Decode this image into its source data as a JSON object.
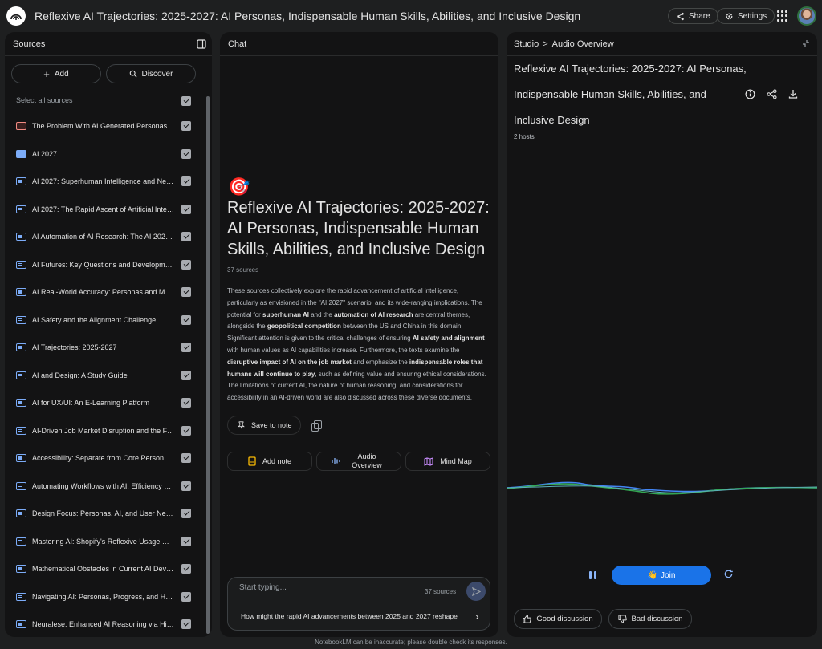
{
  "app": {
    "title": "Reflexive AI Trajectories: 2025-2027: AI Personas, Indispensable Human Skills, Abilities, and Inclusive Design",
    "share_label": "Share",
    "settings_label": "Settings"
  },
  "sources": {
    "header": "Sources",
    "add_label": "Add",
    "discover_label": "Discover",
    "select_all_label": "Select all sources",
    "items": [
      {
        "label": "The Problem With AI Generated Personas...",
        "icon": "pdf-icon"
      },
      {
        "label": "AI 2027",
        "icon": "web-icon"
      },
      {
        "label": "AI 2027: Superhuman Intelligence and Near-...",
        "icon": "doc-icon"
      },
      {
        "label": "AI 2027: The Rapid Ascent of Artificial Intelli...",
        "icon": "doc-icon"
      },
      {
        "label": "AI Automation of AI Research: The AI 2027 S...",
        "icon": "doc-icon"
      },
      {
        "label": "AI Futures: Key Questions and Developments",
        "icon": "doc-icon"
      },
      {
        "label": "AI Real-World Accuracy: Personas and Mod...",
        "icon": "doc-icon"
      },
      {
        "label": "AI Safety and the Alignment Challenge",
        "icon": "doc-icon"
      },
      {
        "label": "AI Trajectories: 2025-2027",
        "icon": "doc-icon"
      },
      {
        "label": "AI and Design: A Study Guide",
        "icon": "doc-icon"
      },
      {
        "label": "AI for UX/UI: An E-Learning Platform",
        "icon": "doc-icon"
      },
      {
        "label": "AI-Driven Job Market Disruption and the Fut...",
        "icon": "doc-icon"
      },
      {
        "label": "Accessibility: Separate from Core Persona F...",
        "icon": "doc-icon"
      },
      {
        "label": "Automating Workflows with AI: Efficiency an...",
        "icon": "doc-icon"
      },
      {
        "label": "Design Focus: Personas, AI, and User Needs",
        "icon": "doc-icon"
      },
      {
        "label": "Mastering AI: Shopify's Reflexive Usage Mod...",
        "icon": "doc-icon"
      },
      {
        "label": "Mathematical Obstacles in Current AI Devel...",
        "icon": "doc-icon"
      },
      {
        "label": "Navigating AI: Personas, Progress, and Hum...",
        "icon": "doc-icon"
      },
      {
        "label": "Neuralese: Enhanced AI Reasoning via High-...",
        "icon": "doc-icon"
      }
    ]
  },
  "chat": {
    "header": "Chat",
    "emoji": "🎯",
    "title": "Reflexive AI Trajectories: 2025-2027: AI Personas, Indispensable Human Skills, Abilities, and Inclusive Design",
    "source_count": "37 sources",
    "summary": {
      "t1": "These sources collectively explore the rapid advancement of artificial intelligence, particularly as envisioned in the \"AI 2027\" scenario, and its wide-ranging implications. The potential for ",
      "b1": "superhuman AI",
      "t2": " and the ",
      "b2": "automation of AI research",
      "t3": " are central themes, alongside the ",
      "b3": "geopolitical competition",
      "t4": " between the US and China in this domain. Significant attention is given to the critical challenges of ensuring ",
      "b4": "AI safety and alignment",
      "t5": " with human values as AI capabilities increase. Furthermore, the texts examine the ",
      "b5": "disruptive impact of AI on the job market",
      "t6": " and emphasize the ",
      "b6": "indispensable roles that humans will continue to play",
      "t7": ", such as defining value and ensuring ethical considerations. The limitations of current AI, the nature of human reasoning, and considerations for accessibility in an AI-driven world are also discussed across these diverse documents."
    },
    "save_to_note_label": "Save to note",
    "add_note_label": "Add note",
    "audio_overview_label": "Audio Overview",
    "mind_map_label": "Mind Map",
    "input_placeholder": "Start typing...",
    "input_source_count": "37 sources",
    "suggestion": "How might the rapid AI advancements between 2025 and 2027 reshape"
  },
  "studio": {
    "crumb_root": "Studio",
    "crumb_sep": ">",
    "crumb_current": "Audio Overview",
    "audio_title": "Reflexive AI Trajectories: 2025-2027: AI Personas, Indispensable Human Skills, Abilities, and Inclusive Design",
    "hosts": "2 hosts",
    "join_label": "Join",
    "good_label": "Good discussion",
    "bad_label": "Bad discussion"
  },
  "footer": {
    "note": "NotebookLM can be inaccurate; please double check its responses."
  },
  "colors": {
    "background": "#1e1f20",
    "panel": "#131314",
    "accent_blue": "#1a73e8",
    "wave_green": "#34a853",
    "wave_blue": "#4285f4"
  }
}
